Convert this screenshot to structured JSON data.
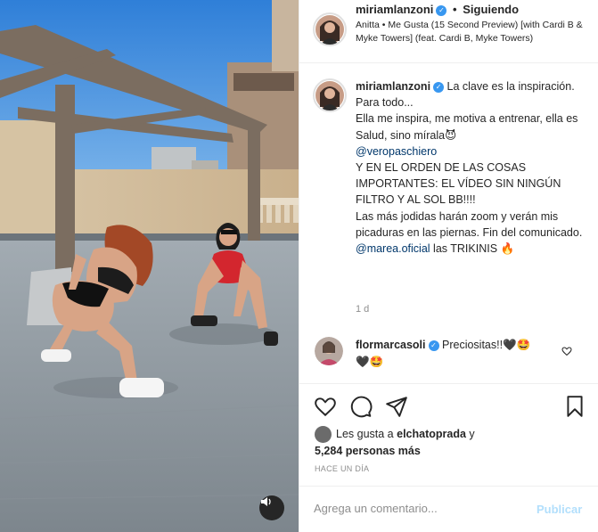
{
  "post": {
    "username": "miriamlanzoni",
    "separator": "•",
    "follow_status": "Siguiendo",
    "song": "Anitta • Me Gusta (15 Second Preview) [with Cardi B & Myke Towers] (feat. Cardi B, Myke Towers)"
  },
  "caption": {
    "username": "miriamlanzoni",
    "line1": "La clave es la inspiración.",
    "line2": "Para todo...",
    "line3": "Ella me inspira, me motiva a entrenar, ella es Salud, sino mírala",
    "emoji_devil": "😈",
    "mention1": "@veropaschiero",
    "line4": "Y EN EL ORDEN DE LAS COSAS IMPORTANTES: EL VÍDEO SIN NINGÚN FILTRO Y AL SOL BB!!!!",
    "line5": "Las más jodidas harán zoom y verán mis picaduras en las piernas. Fin del comunicado.",
    "mention2": "@marea.oficial",
    "line6": "las TRIKINIS",
    "emoji_fire": "🔥",
    "time_ago": "1 d"
  },
  "comment": {
    "username": "flormarcasoli",
    "text": "Preciositas!!",
    "emoji_heart": "🖤",
    "emoji_star": "🤩"
  },
  "likes": {
    "prefix": "Les gusta a",
    "user": "elchatoprada",
    "conj": "y",
    "count": "5,284 personas más"
  },
  "date_label": "HACE UN DÍA",
  "add_comment": {
    "placeholder": "Agrega un comentario...",
    "post_label": "Publicar"
  },
  "icons": {
    "verified": "verified-badge-icon",
    "like": "heart-icon",
    "comment": "comment-icon",
    "share": "paper-plane-icon",
    "save": "bookmark-icon",
    "audio": "speaker-icon"
  },
  "colors": {
    "verified": "#3897f0",
    "link": "#00376b",
    "muted": "#8e8e8e",
    "post_button_disabled": "#b2dffc",
    "border": "#efefef"
  }
}
